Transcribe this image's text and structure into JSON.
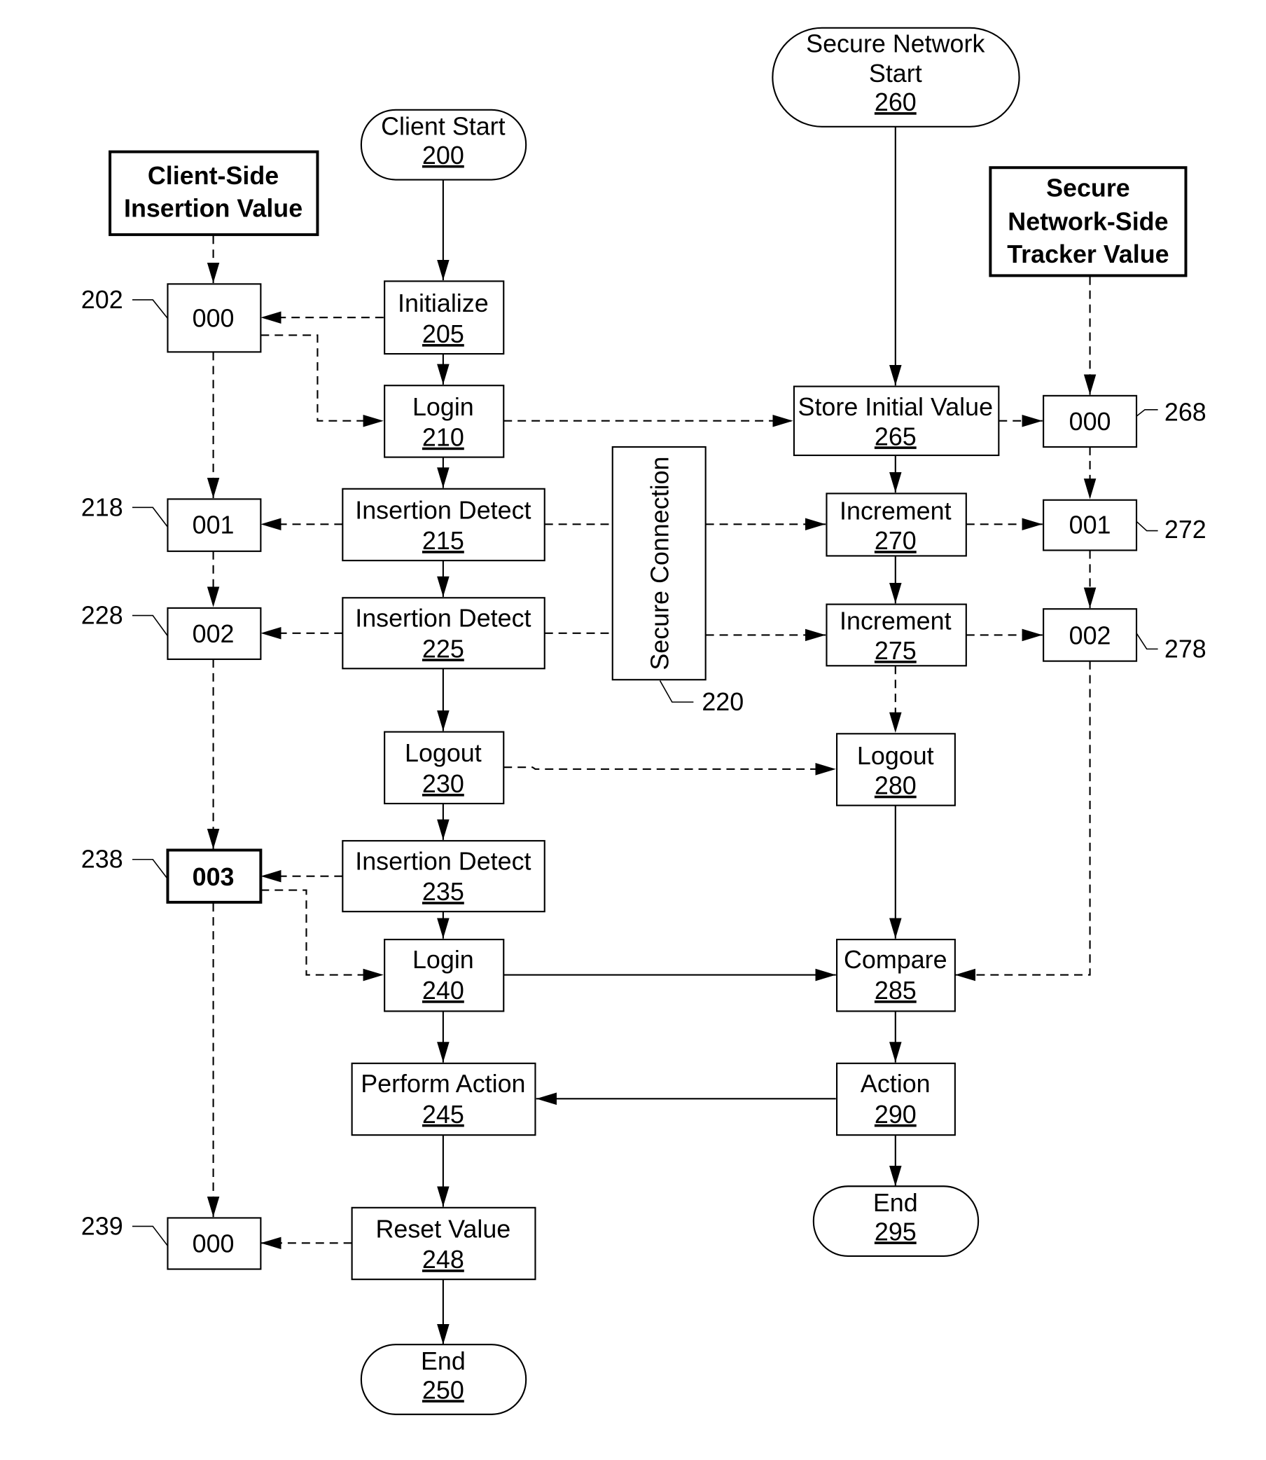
{
  "diagram": {
    "client_side_label": [
      "Client-Side",
      "Insertion Value"
    ],
    "network_side_label": [
      "Secure",
      "Network-Side",
      "Tracker Value"
    ],
    "secure_connection": {
      "label": "Secure Connection",
      "ref": "220"
    },
    "nodes": {
      "client_start": {
        "label": "Client Start",
        "num": "200"
      },
      "initialize": {
        "label": "Initialize",
        "num": "205"
      },
      "login_210": {
        "label": "Login",
        "num": "210"
      },
      "detect_215": {
        "label": "Insertion Detect",
        "num": "215"
      },
      "detect_225": {
        "label": "Insertion Detect",
        "num": "225"
      },
      "logout_230": {
        "label": "Logout",
        "num": "230"
      },
      "detect_235": {
        "label": "Insertion Detect",
        "num": "235"
      },
      "login_240": {
        "label": "Login",
        "num": "240"
      },
      "perform_245": {
        "label": "Perform Action",
        "num": "245"
      },
      "reset_248": {
        "label": "Reset Value",
        "num": "248"
      },
      "end_250": {
        "label": "End",
        "num": "250"
      },
      "net_start": {
        "label1": "Secure Network",
        "label2": "Start",
        "num": "260"
      },
      "store_265": {
        "label": "Store Initial Value",
        "num": "265"
      },
      "inc_270": {
        "label": "Increment",
        "num": "270"
      },
      "inc_275": {
        "label": "Increment",
        "num": "275"
      },
      "logout_280": {
        "label": "Logout",
        "num": "280"
      },
      "compare_285": {
        "label": "Compare",
        "num": "285"
      },
      "action_290": {
        "label": "Action",
        "num": "290"
      },
      "end_295": {
        "label": "End",
        "num": "295"
      }
    },
    "client_values": [
      {
        "value": "000",
        "ref": "202"
      },
      {
        "value": "001",
        "ref": "218"
      },
      {
        "value": "002",
        "ref": "228"
      },
      {
        "value": "003",
        "ref": "238"
      },
      {
        "value": "000",
        "ref": "239"
      }
    ],
    "network_values": [
      {
        "value": "000",
        "ref": "268"
      },
      {
        "value": "001",
        "ref": "272"
      },
      {
        "value": "002",
        "ref": "278"
      }
    ]
  }
}
